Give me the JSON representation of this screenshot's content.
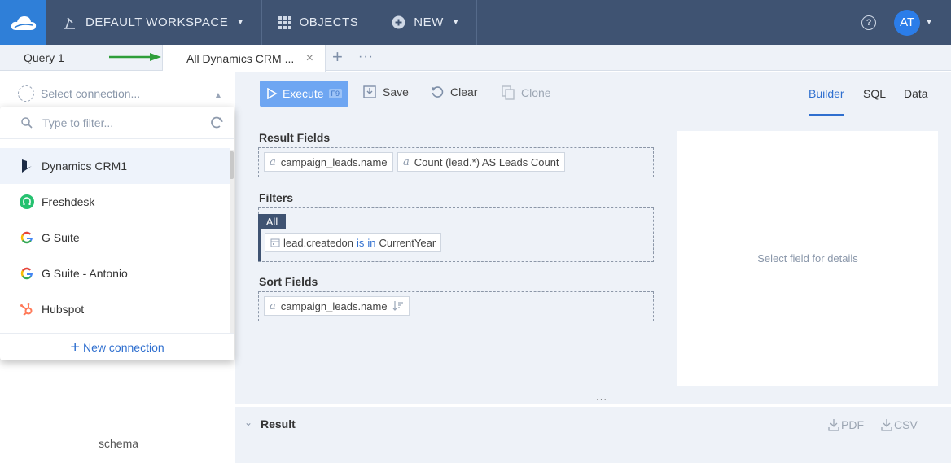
{
  "nav": {
    "workspace_label": "DEFAULT WORKSPACE",
    "objects_label": "OBJECTS",
    "new_label": "NEW",
    "help_symbol": "?",
    "avatar_initials": "AT"
  },
  "tabs": [
    {
      "label": "Query 1"
    },
    {
      "label": "All Dynamics CRM ...",
      "close": "×"
    }
  ],
  "tab_add": "+",
  "tab_more": "···",
  "connection": {
    "placeholder": "Select connection...",
    "filter_placeholder": "Type to filter...",
    "items": [
      {
        "label": "Dynamics CRM1",
        "icon": "dynamics-icon"
      },
      {
        "label": "Freshdesk",
        "icon": "freshdesk-icon"
      },
      {
        "label": "G Suite",
        "icon": "google-icon"
      },
      {
        "label": "G Suite - Antonio",
        "icon": "google-icon"
      },
      {
        "label": "Hubspot",
        "icon": "hubspot-icon"
      }
    ],
    "new_connection_label": "New connection",
    "schema_text": "schema"
  },
  "toolbar": {
    "execute_label": "Execute",
    "execute_key": "F9",
    "save_label": "Save",
    "clear_label": "Clear",
    "clone_label": "Clone"
  },
  "views": {
    "builder": "Builder",
    "sql": "SQL",
    "data": "Data"
  },
  "query": {
    "result_fields_title": "Result Fields",
    "result_fields": [
      {
        "type_glyph": "a",
        "label": "campaign_leads.name"
      },
      {
        "type_glyph": "a",
        "label": "Count (lead.*) AS Leads Count"
      }
    ],
    "filters_title": "Filters",
    "filter_group": "All",
    "filter": {
      "field": "lead.createdon",
      "op1": "is",
      "op2": "in",
      "value": "CurrentYear"
    },
    "sort_fields_title": "Sort Fields",
    "sort_fields": [
      {
        "type_glyph": "a",
        "label": "campaign_leads.name"
      }
    ]
  },
  "details_placeholder": "Select field for details",
  "resize_handle": "···",
  "result": {
    "title": "Result",
    "pdf_label": "PDF",
    "csv_label": "CSV"
  },
  "colors": {
    "nav_bg": "#3f5372",
    "logo_bg": "#2f7fd8",
    "accent": "#2f6fcf",
    "arrow": "#2e9e3a"
  }
}
